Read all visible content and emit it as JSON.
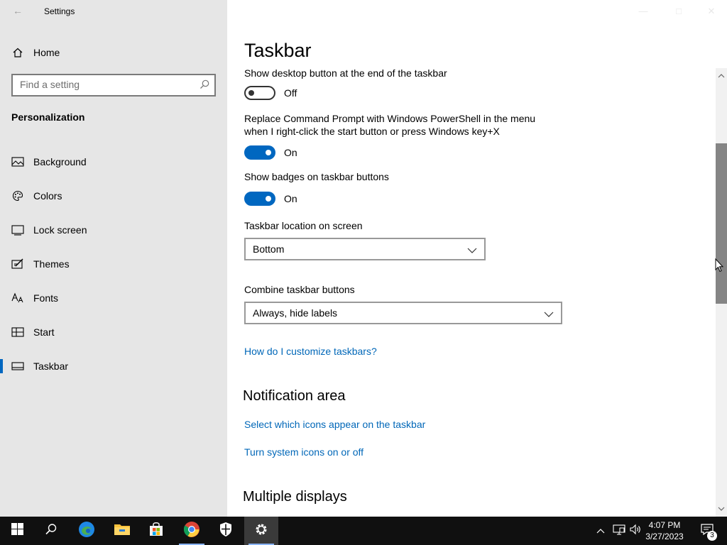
{
  "window": {
    "title": "Settings"
  },
  "sidebar": {
    "home_label": "Home",
    "search_placeholder": "Find a setting",
    "section": "Personalization",
    "items": [
      {
        "label": "Background",
        "icon": "picture-icon"
      },
      {
        "label": "Colors",
        "icon": "palette-icon"
      },
      {
        "label": "Lock screen",
        "icon": "lock-screen-icon"
      },
      {
        "label": "Themes",
        "icon": "themes-icon"
      },
      {
        "label": "Fonts",
        "icon": "fonts-icon"
      },
      {
        "label": "Start",
        "icon": "start-icon"
      },
      {
        "label": "Taskbar",
        "icon": "taskbar-icon",
        "active": true
      }
    ]
  },
  "main": {
    "title": "Taskbar",
    "settings": [
      {
        "label": "Show desktop button at the end of the taskbar",
        "state": "Off"
      },
      {
        "label_line1": "Replace Command Prompt with Windows PowerShell in the menu",
        "label_line2": "when I right-click the start button or press Windows key+X",
        "state": "On"
      },
      {
        "label": "Show badges on taskbar buttons",
        "state": "On"
      }
    ],
    "location": {
      "label": "Taskbar location on screen",
      "value": "Bottom"
    },
    "combine": {
      "label": "Combine taskbar buttons",
      "value": "Always, hide labels"
    },
    "help_link": "How do I customize taskbars?",
    "notification_area": {
      "heading": "Notification area",
      "links": [
        "Select which icons appear on the taskbar",
        "Turn system icons on or off"
      ]
    },
    "multiple_displays": {
      "heading": "Multiple displays"
    }
  },
  "taskbar": {
    "time": "4:07 PM",
    "date": "3/27/2023",
    "notification_count": "3",
    "accent": "#0067c0"
  }
}
